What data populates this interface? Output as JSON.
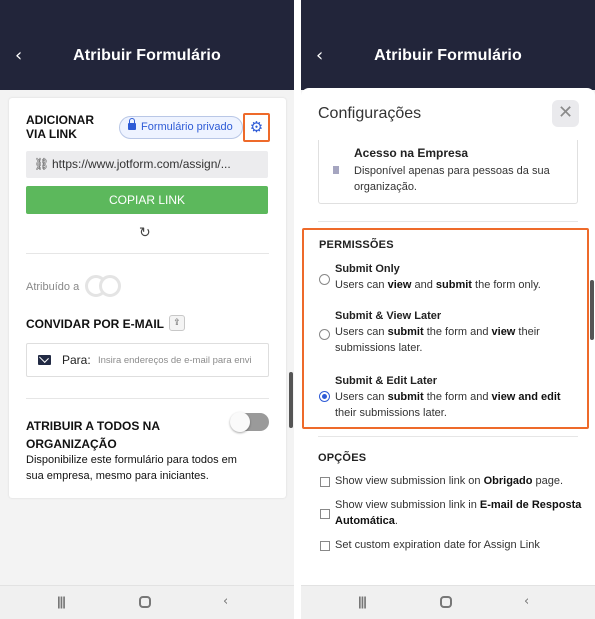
{
  "left_screen": {
    "header": {
      "back_glyph": "‹",
      "title": "Atribuir Formulário"
    },
    "add_via_link": {
      "title_line1": "ADICIONAR",
      "title_line2": "VIA LINK",
      "badge": "Formulário privado",
      "url": "https://www.jotform.com/assign/...",
      "copy_button": "COPIAR LINK"
    },
    "assigned_label": "Atribuído a",
    "invite": {
      "title": "CONVIDAR POR E-MAIL",
      "to_label": "Para:",
      "placeholder": "Insira endereços de e-mail para envi"
    },
    "assign_all": {
      "title_line1": "ATRIBUIR A TODOS NA",
      "title_line2": "ORGANIZAÇÃO",
      "description": "Disponibilize este formulário para todos em sua empresa, mesmo para iniciantes.",
      "toggle_on": false
    }
  },
  "right_screen": {
    "header": {
      "back_glyph": "‹",
      "title": "Atribuir Formulário"
    },
    "sheet_title": "Configurações",
    "close_glyph": "✕",
    "company_access": {
      "name": "Acesso na Empresa",
      "description": "Disponível apenas para pessoas da sua organização."
    },
    "permissions": {
      "title": "PERMISSÕES",
      "options": [
        {
          "title": "Submit Only",
          "desc_parts": [
            "Users can ",
            "view",
            " and ",
            "submit",
            " the form only."
          ],
          "selected": false
        },
        {
          "title": "Submit & View Later",
          "desc_parts": [
            "Users can ",
            "submit",
            " the form and ",
            "view",
            " their submissions later."
          ],
          "selected": false
        },
        {
          "title": "Submit & Edit Later",
          "desc_parts": [
            "Users can ",
            "submit",
            " the form and ",
            "view and edit",
            " their submissions later."
          ],
          "selected": true
        }
      ]
    },
    "options_section": {
      "title": "OPÇÕES",
      "checkboxes": [
        {
          "parts": [
            "Show view submission link on ",
            "Obrigado",
            " page."
          ],
          "checked": false
        },
        {
          "parts": [
            "Show view submission link in ",
            "E-mail de Resposta Automática",
            "."
          ],
          "checked": false
        },
        {
          "parts": [
            "Set custom expiration date for Assign Link",
            "",
            ""
          ],
          "checked": false
        }
      ]
    }
  },
  "nav": {
    "recent": "|||",
    "back": "‹"
  },
  "colors": {
    "header_bg": "#22253a",
    "accent_blue": "#2e5bd6",
    "copy_green": "#5cb85c",
    "highlight_orange": "#ee6a2a"
  }
}
